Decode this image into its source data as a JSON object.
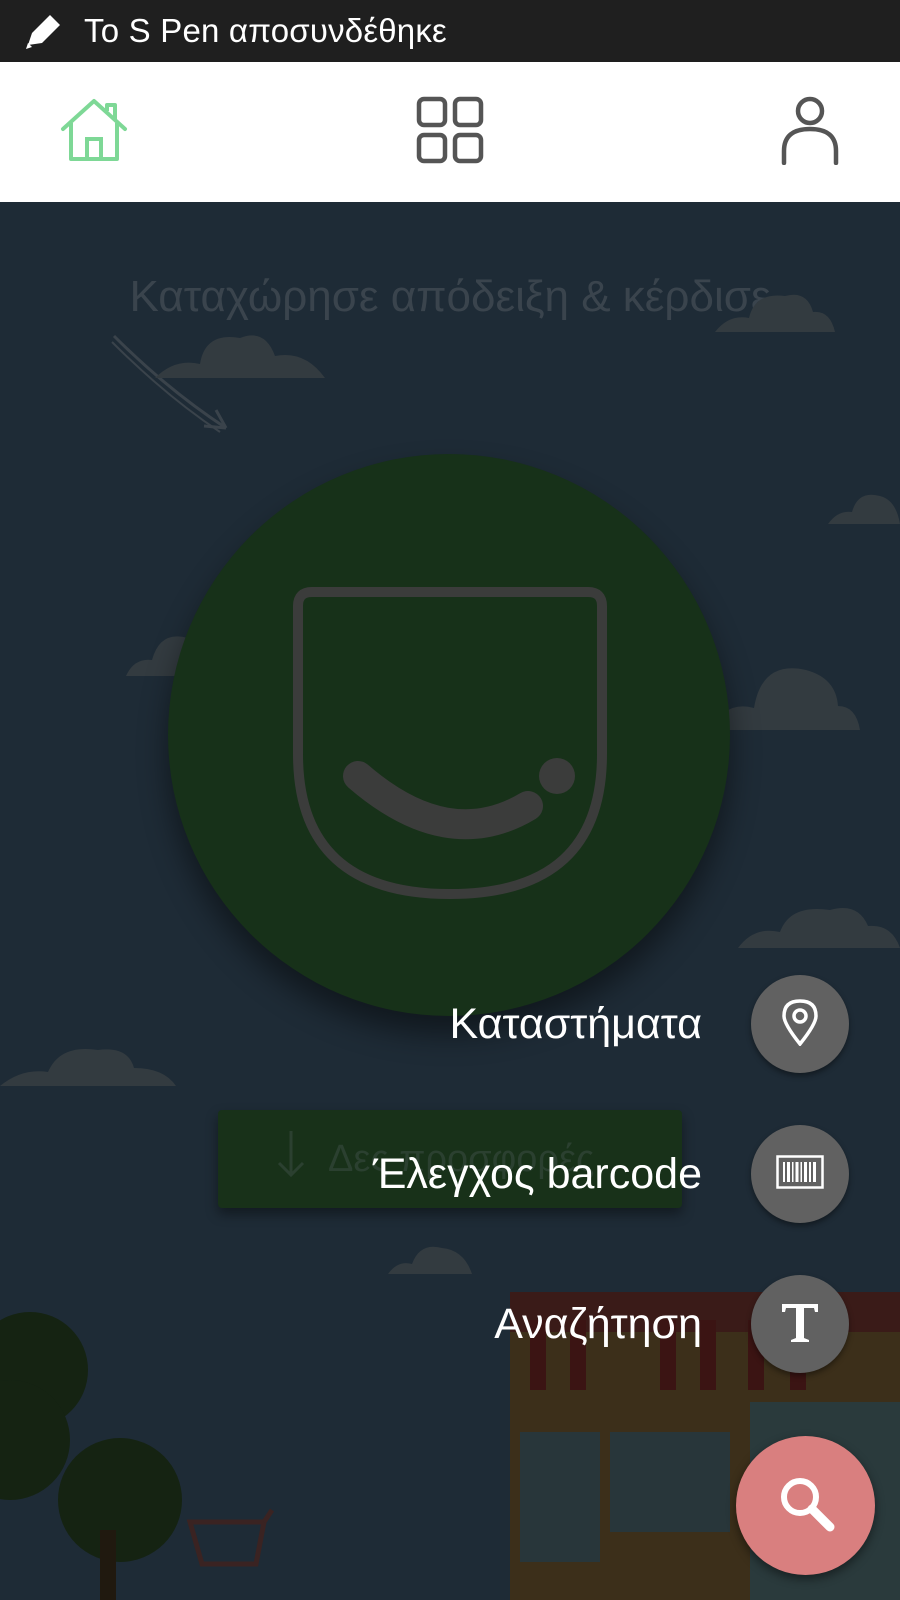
{
  "status_bar": {
    "icon": "pen-icon",
    "text": "Το S Pen αποσυνδέθηκε"
  },
  "nav": {
    "home": {
      "icon": "home-icon",
      "active": true,
      "color": "#7ed896"
    },
    "grid": {
      "icon": "grid-icon"
    },
    "profile": {
      "icon": "user-icon"
    }
  },
  "main": {
    "headline": "Καταχώρησε απόδειξη & κέρδισε",
    "logo": "smile-logo-icon",
    "bg_button": {
      "icon": "arrow-down-icon",
      "label": "Δες προσφορές"
    }
  },
  "fab_menu": {
    "items": [
      {
        "label": "Καταστήματα",
        "icon": "location-pin-icon"
      },
      {
        "label": "Έλεγχος barcode",
        "icon": "barcode-icon"
      },
      {
        "label": "Αναζήτηση",
        "icon": "text-t-icon"
      }
    ],
    "main": {
      "icon": "search-icon",
      "color": "#d97f7f"
    }
  }
}
